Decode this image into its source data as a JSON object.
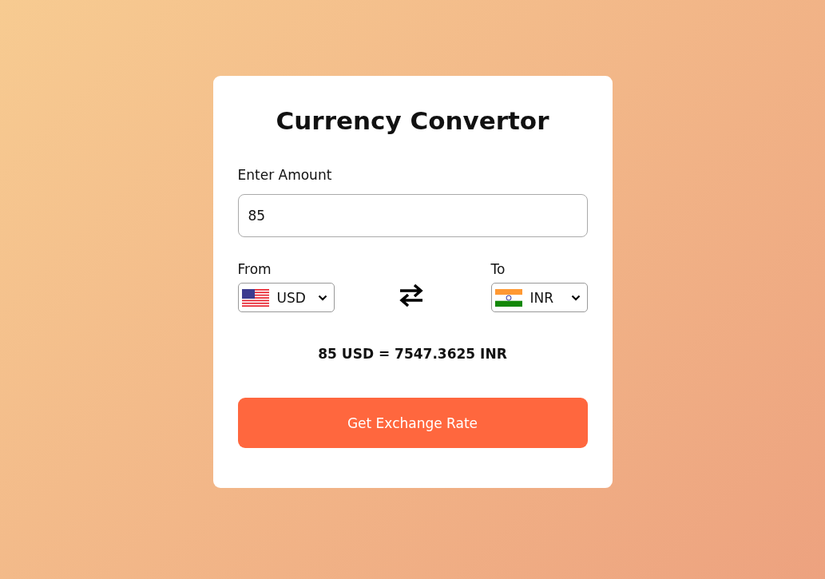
{
  "title": "Currency Convertor",
  "amount": {
    "label": "Enter Amount",
    "value": "85"
  },
  "from": {
    "label": "From",
    "currency": "USD"
  },
  "to": {
    "label": "To",
    "currency": "INR"
  },
  "result": "85 USD = 7547.3625 INR",
  "button": "Get Exchange Rate"
}
